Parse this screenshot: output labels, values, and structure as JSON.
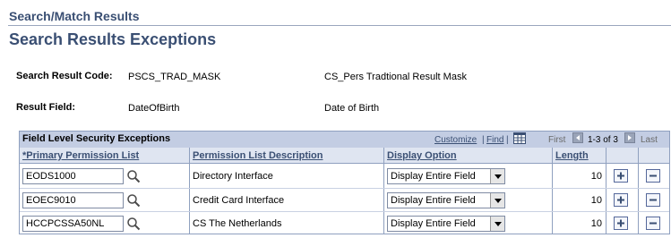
{
  "header": {
    "breadcrumb": "Search/Match Results",
    "page_title": "Search Results Exceptions"
  },
  "fields": {
    "search_result_code_label": "Search Result Code:",
    "search_result_code_value": "PSCS_TRAD_MASK",
    "search_result_code_desc": "CS_Pers Tradtional Result Mask",
    "result_field_label": "Result Field:",
    "result_field_value": "DateOfBirth",
    "result_field_desc": "Date of Birth"
  },
  "grid": {
    "title": "Field Level Security Exceptions",
    "customize": "Customize",
    "sep": "|",
    "find": "Find",
    "first": "First",
    "range": "1-3 of 3",
    "last": "Last",
    "columns": {
      "perm_list": "*Primary Permission List",
      "perm_desc": "Permission List Description",
      "display_option": "Display Option",
      "length": "Length"
    },
    "rows": [
      {
        "perm_list": "EODS1000",
        "desc": "Directory Interface",
        "display_option": "Display Entire Field",
        "length": "10"
      },
      {
        "perm_list": "EOEC9010",
        "desc": "Credit Card Interface",
        "display_option": "Display Entire Field",
        "length": "10"
      },
      {
        "perm_list": "HCCPCSSA50NL",
        "desc": "CS The Netherlands",
        "display_option": "Display Entire Field",
        "length": "10"
      }
    ]
  },
  "icons": {
    "lookup": "magnifier-icon",
    "add": "plus-icon",
    "delete": "minus-icon",
    "download": "grid-download-icon",
    "prev": "arrow-left-icon",
    "next": "arrow-right-icon",
    "dropdown": "chevron-down-icon"
  },
  "colors": {
    "title": "#3a4f73",
    "grid_header_bg": "#c3cde3",
    "column_header_bg": "#dfe5f1",
    "border": "#8fa0bf"
  }
}
